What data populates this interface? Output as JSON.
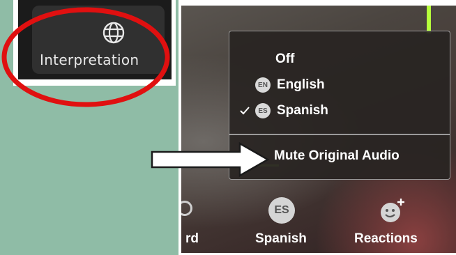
{
  "toolbar_button": {
    "icon": "globe-icon",
    "label": "Interpretation"
  },
  "menu": {
    "items": [
      {
        "label": "Off",
        "badge": null,
        "checked": false
      },
      {
        "label": "English",
        "badge": "EN",
        "checked": false
      },
      {
        "label": "Spanish",
        "badge": "ES",
        "checked": true
      }
    ],
    "mute_label": "Mute Original Audio"
  },
  "bottom_toolbar": {
    "record_label": "rd",
    "language_badge": "ES",
    "language_label": "Spanish",
    "reactions_label": "Reactions",
    "reactions_icon": "smiley-plus-icon"
  },
  "colors": {
    "background": "#8fbca6",
    "highlight": "#e01010",
    "accent_green": "#b6ff3c",
    "menu_bg": "#282422",
    "text": "#ffffff"
  }
}
